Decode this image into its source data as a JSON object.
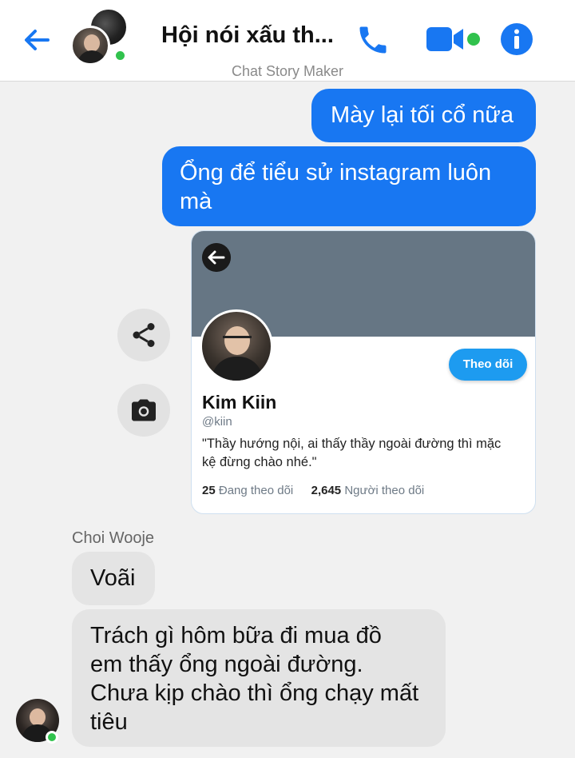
{
  "header": {
    "title": "Hội nói xấu th...",
    "watermark": "Chat Story Maker",
    "icons": [
      "back-arrow-icon",
      "phone-icon",
      "video-camera-icon",
      "info-icon"
    ],
    "accent_color": "#1877f2",
    "online_color": "#31c24d"
  },
  "messages": {
    "out1": "Mày lại tối cổ nữa",
    "out2_line1": "Ổng để tiểu sử instagram luôn",
    "out2_line2": "mà",
    "sender_name": "Choi Wooje",
    "in1": "Voãi",
    "in2_line1": "Trách gì hôm bữa đi mua đồ",
    "in2_line2": "em thấy ổng ngoài đường.",
    "in2_line3": "Chưa kịp chào thì ổng chạy mất",
    "in2_line4": "tiêu"
  },
  "profile_card": {
    "follow_label": "Theo dõi",
    "name": "Kim Kiin",
    "handle": "@kiin",
    "bio_line1": "\"Thầy hướng nội, ai thấy thầy ngoài đường thì mặc",
    "bio_line2": "kệ đừng chào nhé.\"",
    "following_count": "25",
    "following_label": "Đang theo dõi",
    "followers_count": "2,645",
    "followers_label": "Người theo dõi"
  },
  "side_actions": [
    "share-icon",
    "camera-icon"
  ]
}
